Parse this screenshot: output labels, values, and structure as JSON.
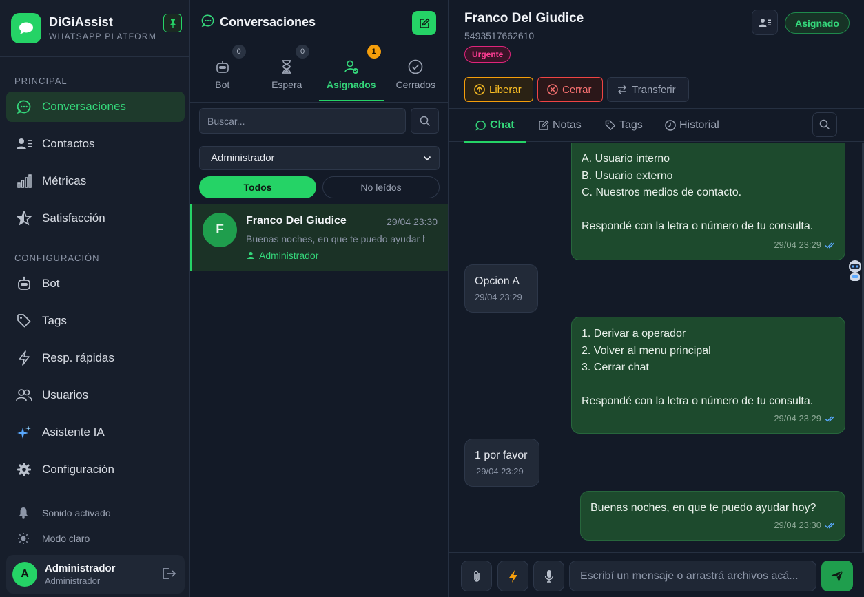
{
  "brand": {
    "title": "DiGiAssist",
    "subtitle": "WHATSAPP PLATFORM"
  },
  "sidebar": {
    "sections": {
      "principal": "PRINCIPAL",
      "config": "CONFIGURACIÓN"
    },
    "items": [
      {
        "label": "Conversaciones",
        "icon": "chat-icon",
        "active": true
      },
      {
        "label": "Contactos",
        "icon": "contacts-icon"
      },
      {
        "label": "Métricas",
        "icon": "bar-chart-icon"
      },
      {
        "label": "Satisfacción",
        "icon": "star-icon"
      },
      {
        "label": "Bot",
        "icon": "robot-icon"
      },
      {
        "label": "Tags",
        "icon": "tag-icon"
      },
      {
        "label": "Resp. rápidas",
        "icon": "bolt-icon"
      },
      {
        "label": "Usuarios",
        "icon": "users-icon"
      },
      {
        "label": "Asistente IA",
        "icon": "sparkles-icon"
      },
      {
        "label": "Configuración",
        "icon": "gear-icon"
      }
    ],
    "sound_label": "Sonido activado",
    "theme_label": "Modo claro",
    "user": {
      "initial": "A",
      "name": "Administrador",
      "role": "Administrador"
    }
  },
  "conversations": {
    "title": "Conversaciones",
    "filters": [
      {
        "label": "Bot",
        "count": "0"
      },
      {
        "label": "Espera",
        "count": "0"
      },
      {
        "label": "Asignados",
        "count": "1",
        "active": true
      },
      {
        "label": "Cerrados",
        "count": ""
      }
    ],
    "search_placeholder": "Buscar...",
    "agent_filter": "Administrador",
    "segments": {
      "all": "Todos",
      "unread": "No leídos"
    },
    "items": [
      {
        "initial": "F",
        "name": "Franco Del Giudice",
        "time": "29/04 23:30",
        "preview": "Buenas noches, en que te puedo ayudar hoy?",
        "agent": "Administrador"
      }
    ]
  },
  "chat": {
    "contact_name": "Franco Del Giudice",
    "contact_phone": "5493517662610",
    "priority_tag": "Urgente",
    "status": "Asignado",
    "actions": {
      "release": "Liberar",
      "close": "Cerrar",
      "transfer": "Transferir"
    },
    "tabs": {
      "chat": "Chat",
      "notes": "Notas",
      "tags": "Tags",
      "history": "Historial"
    },
    "messages": [
      {
        "direction": "out",
        "lines": [
          "A. Usuario interno",
          "B. Usuario externo",
          "C. Nuestros medios de contacto.",
          "",
          "Respondé con la letra o número de tu consulta."
        ],
        "time": "29/04 23:29"
      },
      {
        "direction": "in",
        "lines": [
          "Opcion A"
        ],
        "time": "29/04 23:29"
      },
      {
        "direction": "out",
        "lines": [
          "1. Derivar a operador",
          "2. Volver al menu principal",
          "3. Cerrar chat",
          "",
          "Respondé con la letra o número de tu consulta."
        ],
        "time": "29/04 23:29"
      },
      {
        "direction": "in",
        "lines": [
          "1 por favor"
        ],
        "time": "29/04 23:29"
      },
      {
        "direction": "out",
        "lines": [
          "Buenas noches, en que te puedo ayudar hoy?"
        ],
        "time": "29/04 23:30"
      }
    ],
    "composer_placeholder": "Escribí un mensaje o arrastrá archivos acá..."
  },
  "colors": {
    "accent": "#25d366",
    "urgent": "#ff3d93",
    "warning": "#f59e0b",
    "danger": "#ef4444"
  }
}
